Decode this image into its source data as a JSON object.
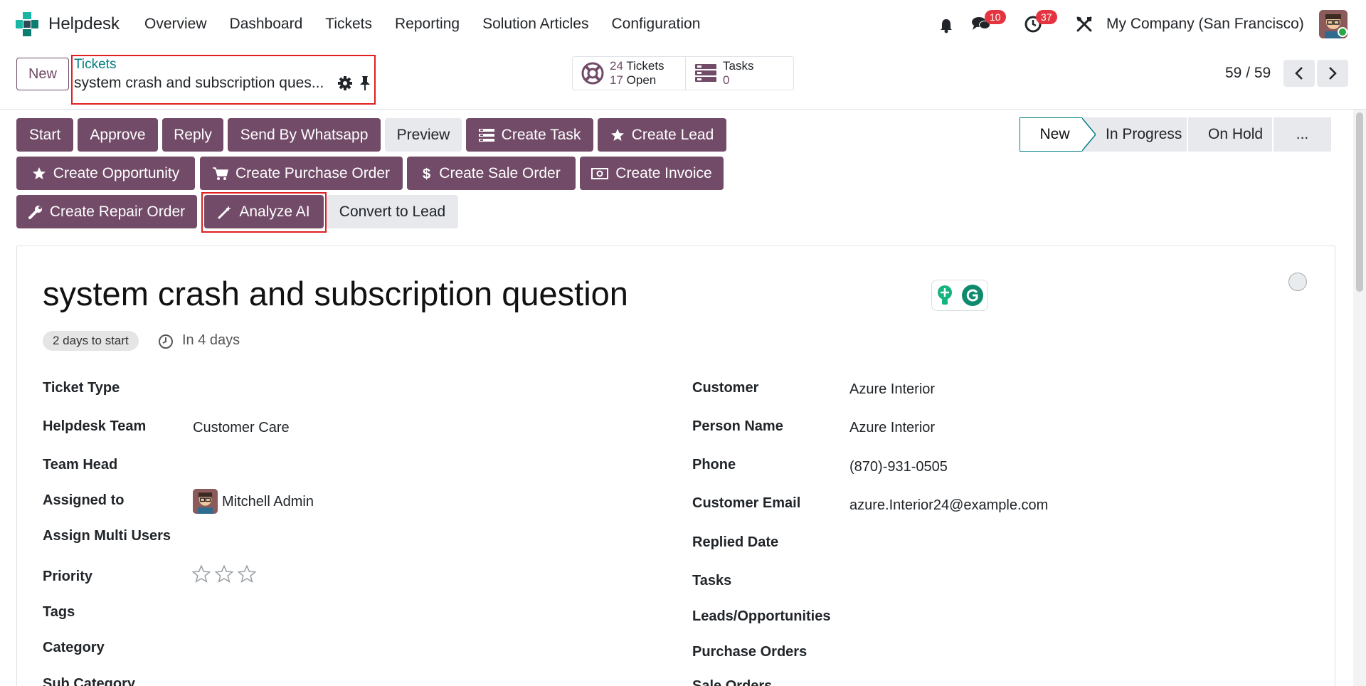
{
  "navbar": {
    "app_name": "Helpdesk",
    "menu": [
      "Overview",
      "Dashboard",
      "Tickets",
      "Reporting",
      "Solution Articles",
      "Configuration"
    ],
    "messages_count": "10",
    "activities_count": "37",
    "company": "My Company (San Francisco)"
  },
  "control_panel": {
    "new_label": "New",
    "breadcrumb_parent": "Tickets",
    "breadcrumb_current": "system crash and subscription ques...",
    "stats": {
      "tickets_count": "24",
      "tickets_label": "Tickets",
      "open_count": "17",
      "open_label": "Open",
      "tasks_label": "Tasks",
      "tasks_count": "0"
    },
    "pager": "59 / 59"
  },
  "actions": {
    "row1": [
      "Start",
      "Approve",
      "Reply",
      "Send By Whatsapp",
      "Preview",
      "Create Task",
      "Create Lead"
    ],
    "row2": [
      "Create Opportunity",
      "Create Purchase Order",
      "Create Sale Order",
      "Create Invoice"
    ],
    "row3": [
      "Create Repair Order",
      "Analyze AI",
      "Convert to Lead"
    ]
  },
  "statusbar": {
    "stages": [
      "New",
      "In Progress",
      "On Hold",
      "..."
    ],
    "active": "New"
  },
  "form": {
    "title": "system crash and subscription question",
    "start_badge": "2 days to start",
    "deadline": "In 4 days",
    "left": {
      "ticket_type_label": "Ticket Type",
      "team_label": "Helpdesk Team",
      "team_value": "Customer Care",
      "team_head_label": "Team Head",
      "assigned_label": "Assigned to",
      "assigned_value": "Mitchell Admin",
      "multi_users_label": "Assign Multi Users",
      "priority_label": "Priority",
      "tags_label": "Tags",
      "category_label": "Category",
      "subcategory_label": "Sub Category"
    },
    "right": {
      "customer_label": "Customer",
      "customer_value": "Azure Interior",
      "person_label": "Person Name",
      "person_value": "Azure Interior",
      "phone_label": "Phone",
      "phone_value": "(870)-931-0505",
      "email_label": "Customer Email",
      "email_value": "azure.Interior24@example.com",
      "replied_label": "Replied Date",
      "tasks_label": "Tasks",
      "leads_label": "Leads/Opportunities",
      "po_label": "Purchase Orders",
      "so_label": "Sale Orders"
    }
  },
  "colors": {
    "primary": "#714b67",
    "teal": "#017e84",
    "badge_red": "#e4343f",
    "highlight_red": "#e02020"
  }
}
